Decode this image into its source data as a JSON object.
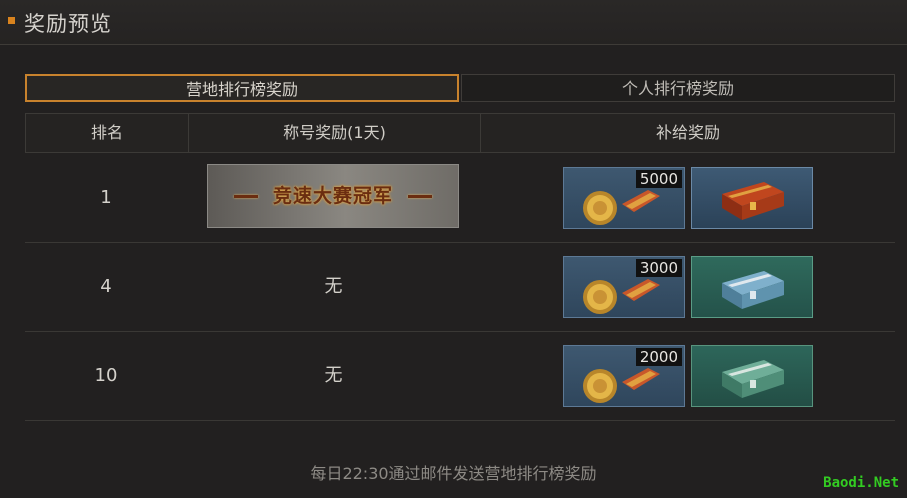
{
  "header": {
    "title": "奖励预览"
  },
  "tabs": [
    {
      "label": "营地排行榜奖励",
      "active": true
    },
    {
      "label": "个人排行榜奖励",
      "active": false
    }
  ],
  "table": {
    "columns": [
      "排名",
      "称号奖励(1天)",
      "补给奖励"
    ],
    "rows": [
      {
        "rank": "1",
        "title_reward": "竞速大赛冠军",
        "supplies": [
          {
            "icon": "medal-icon",
            "quantity": "5000"
          },
          {
            "icon": "red-chest-icon"
          }
        ]
      },
      {
        "rank": "4",
        "title_reward": "无",
        "supplies": [
          {
            "icon": "medal-icon",
            "quantity": "3000"
          },
          {
            "icon": "blue-chest-icon"
          }
        ]
      },
      {
        "rank": "10",
        "title_reward": "无",
        "supplies": [
          {
            "icon": "medal-icon",
            "quantity": "2000"
          },
          {
            "icon": "green-chest-icon"
          }
        ]
      }
    ]
  },
  "footer": {
    "note": "每日22:30通过邮件发送营地排行榜奖励"
  },
  "watermark": "Baodi.Net",
  "colors": {
    "accent": "#d9831e",
    "background": "#222020"
  }
}
